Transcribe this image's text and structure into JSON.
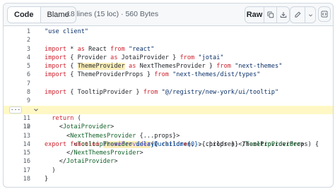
{
  "toolbar": {
    "code_tab": "Code",
    "blame_tab": "Blame",
    "file_meta": "18 lines (15 loc) · 560 Bytes",
    "raw_label": "Raw",
    "icons": [
      "copy-icon",
      "download-icon",
      "pencil-icon",
      "chevron-down-icon",
      "code-square-icon"
    ]
  },
  "gutter": {
    "more_label": "···"
  },
  "code": {
    "line_numbers": [
      "1",
      "2",
      "3",
      "4",
      "5",
      "6",
      "7",
      "8",
      "9",
      "10",
      "11",
      "12",
      "13",
      "14",
      "15",
      "16",
      "17",
      "18"
    ],
    "highlighted_line": "10",
    "lines": [
      [
        "\"use client\""
      ],
      [
        ""
      ],
      [
        "import",
        " * ",
        "as",
        " React ",
        "from",
        " ",
        "\"react\""
      ],
      [
        "import",
        " { Provider ",
        "as",
        " JotaiProvider } ",
        "from",
        " ",
        "\"jotai\""
      ],
      [
        "import",
        " { ",
        "ThemeProvider",
        " ",
        "as",
        " NextThemesProvider } ",
        "from",
        " ",
        "\"next-themes\""
      ],
      [
        "import",
        " { ThemeProviderProps } ",
        "from",
        " ",
        "\"next-themes/dist/types\""
      ],
      [
        ""
      ],
      [
        "import",
        " { TooltipProvider } ",
        "from",
        " ",
        "\"@/registry/new-york/ui/tooltip\""
      ],
      [
        ""
      ],
      [
        "export",
        " ",
        "function",
        " ",
        "ThemeProvider",
        "({ children, ...props }: ThemeProviderProps) {"
      ],
      [
        "  ",
        "return",
        " ("
      ],
      [
        "    <",
        "JotaiProvider",
        ">"
      ],
      [
        "      <",
        "NextThemesProvider",
        " {...props}>"
      ],
      [
        "        <",
        "TooltipProvider",
        " ",
        "delayDuration",
        "=",
        "{0}",
        ">{children}</",
        "TooltipProvider",
        ">"
      ],
      [
        "      </",
        "NextThemesProvider",
        ">"
      ],
      [
        "    </",
        "JotaiProvider",
        ">"
      ],
      [
        "  )"
      ],
      [
        "}"
      ]
    ]
  }
}
